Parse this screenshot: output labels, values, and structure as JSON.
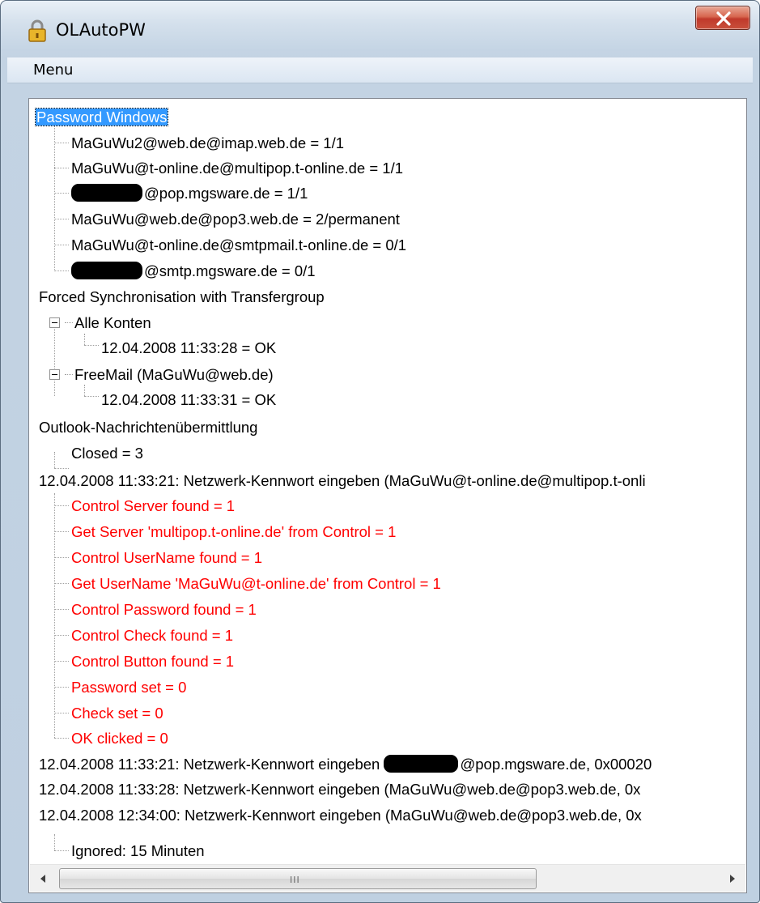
{
  "window": {
    "title": "OLAutoPW"
  },
  "menu": {
    "label": "Menu"
  },
  "tree": {
    "root_password_windows": "Password Windows",
    "pw_items": [
      "MaGuWu2@web.de@imap.web.de  =  1/1",
      "MaGuWu@t-online.de@multipop.t-online.de  =  1/1",
      "@pop.mgsware.de  =  1/1",
      "MaGuWu@web.de@pop3.web.de  =  2/permanent",
      "MaGuWu@t-online.de@smtpmail.t-online.de  =  0/1",
      "@smtp.mgsware.de  =  0/1"
    ],
    "root_forced_sync": "Forced Synchronisation with Transfergroup",
    "group_alle_konten": "Alle Konten",
    "alle_konten_entry": "12.04.2008 11:33:28  =  OK",
    "group_freemail": "FreeMail (MaGuWu@web.de)",
    "freemail_entry": "12.04.2008 11:33:31  =  OK",
    "root_outlook": "Outlook-Nachrichtenübermittlung",
    "outlook_entry": "Closed  =  3",
    "root_event_1": "12.04.2008 11:33:21: Netzwerk-Kennwort eingeben  (MaGuWu@t-online.de@multipop.t-onli",
    "event_1_items": [
      "Control Server found  =  1",
      "Get Server 'multipop.t-online.de' from Control  =  1",
      "Control UserName found  =  1",
      "Get UserName 'MaGuWu@t-online.de' from Control  =  1",
      "Control Password found  =  1",
      "Control Check found  =  1",
      "Control Button found  =  1",
      "Password set  =  0",
      "Check set  =  0",
      "OK clicked  =  0"
    ],
    "root_event_2_prefix": "12.04.2008 11:33:21: Netzwerk-Kennwort eingeben ",
    "root_event_2_suffix": "@pop.mgsware.de, 0x00020",
    "root_event_3": "12.04.2008 11:33:28: Netzwerk-Kennwort eingeben  (MaGuWu@web.de@pop3.web.de, 0x",
    "root_event_4": "12.04.2008 12:34:00: Netzwerk-Kennwort eingeben  (MaGuWu@web.de@pop3.web.de, 0x",
    "event_4_entry": "Ignored: 15 Minuten"
  },
  "scrollbar": {
    "grip": "III"
  },
  "colors": {
    "error_text": "#ff0000",
    "selection": "#3399ff"
  },
  "icons": {
    "app": "padlock-icon",
    "close": "close-x-icon"
  }
}
